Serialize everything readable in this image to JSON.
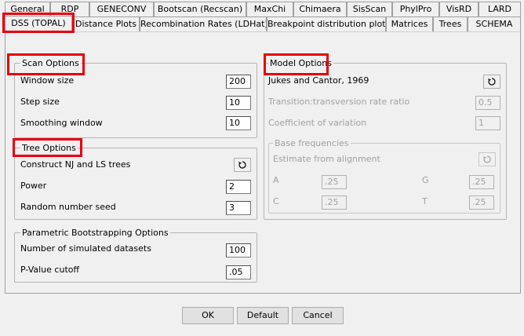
{
  "tabs_row1": [
    "General",
    "RDP",
    "GENECONV",
    "Bootscan (Recscan)",
    "MaxChi",
    "Chimaera",
    "SisScan",
    "PhylPro",
    "VisRD",
    "LARD"
  ],
  "tabs_row2": [
    "DSS (TOPAL)",
    "Distance Plots",
    "Recombination Rates (LDHat)",
    "Breakpoint distribution plot",
    "Matrices",
    "Trees",
    "SCHEMA"
  ],
  "scan_options": {
    "title": "Scan Options",
    "window_size_label": "Window size",
    "window_size_value": "200",
    "step_size_label": "Step size",
    "step_size_value": "10",
    "smoothing_window_label": "Smoothing window",
    "smoothing_window_value": "10"
  },
  "tree_options": {
    "title": "Tree Options",
    "construct_label": "Construct NJ and LS trees",
    "power_label": "Power",
    "power_value": "2",
    "seed_label": "Random number seed",
    "seed_value": "3"
  },
  "bootstrap_options": {
    "title": "Parametric Bootstrapping Options",
    "datasets_label": "Number of simulated datasets",
    "datasets_value": "100",
    "pvalue_label": "P-Value cutoff",
    "pvalue_value": ".05"
  },
  "model_options": {
    "title": "Model Options",
    "model_name": "Jukes and Cantor, 1969",
    "ti_tv_label": "Transition:transversion rate ratio",
    "ti_tv_value": "0.5",
    "cv_label": "Coefficient of variation",
    "cv_value": "1",
    "base_freq": {
      "title": "Base frequencies",
      "estimate_label": "Estimate from alignment",
      "a_label": "A",
      "a_value": ".25",
      "c_label": "C",
      "c_value": ".25",
      "g_label": "G",
      "g_value": ".25",
      "t_label": "T",
      "t_value": ".25"
    }
  },
  "buttons": {
    "ok": "OK",
    "default": "Default",
    "cancel": "Cancel"
  },
  "colors": {
    "highlight": "#e8000b",
    "background": "#f0f0f0"
  },
  "icons": {
    "cycle": "refresh-cycle-icon"
  }
}
